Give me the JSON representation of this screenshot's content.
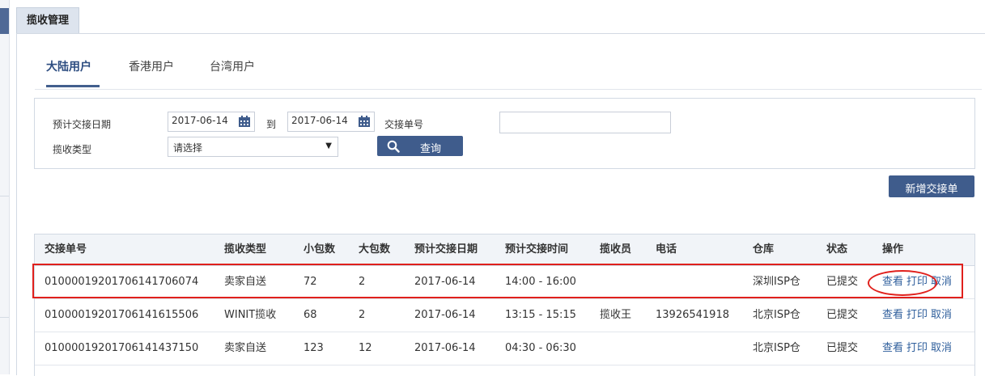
{
  "header": {
    "tab_title": "揽收管理"
  },
  "subtabs": [
    {
      "label": "大陆用户",
      "active": true
    },
    {
      "label": "香港用户",
      "active": false
    },
    {
      "label": "台湾用户",
      "active": false
    }
  ],
  "filters": {
    "date_label": "预计交接日期",
    "date_from": "2017-06-14",
    "to_label": "到",
    "date_to": "2017-06-14",
    "order_no_label": "交接单号",
    "order_no_value": "",
    "type_label": "揽收类型",
    "type_selected": "请选择",
    "query_button": "查询"
  },
  "actions": {
    "new_button": "新增交接单"
  },
  "table": {
    "headers": [
      "交接单号",
      "揽收类型",
      "小包数",
      "大包数",
      "预计交接日期",
      "预计交接时间",
      "揽收员",
      "电话",
      "仓库",
      "状态",
      "操作"
    ],
    "rows": [
      {
        "order_no": "0100001920170614170607​4",
        "type": "卖家自送",
        "small": "72",
        "large": "2",
        "date": "2017-06-14",
        "time": "14:00 - 16:00",
        "collector": "",
        "phone": "",
        "warehouse": "深圳ISP仓",
        "status": "已提交"
      },
      {
        "order_no": "010000192017061416155​06",
        "type": "WINIT揽收",
        "small": "68",
        "large": "2",
        "date": "2017-06-14",
        "time": "13:15 - 15:15",
        "collector": "揽收王",
        "phone": "13926541918",
        "warehouse": "北京ISP仓",
        "status": "已提交"
      },
      {
        "order_no": "010000192017061414371​50",
        "type": "卖家自送",
        "small": "123",
        "large": "12",
        "date": "2017-06-14",
        "time": "04:30 - 06:30",
        "collector": "",
        "phone": "",
        "warehouse": "北京ISP仓",
        "status": "已提交"
      }
    ],
    "row_actions": {
      "view": "查看",
      "print": "打印",
      "cancel": "取消"
    }
  },
  "colors": {
    "accent": "#3f5c8c",
    "link": "#2f5f9c",
    "highlight": "#e0201c"
  }
}
